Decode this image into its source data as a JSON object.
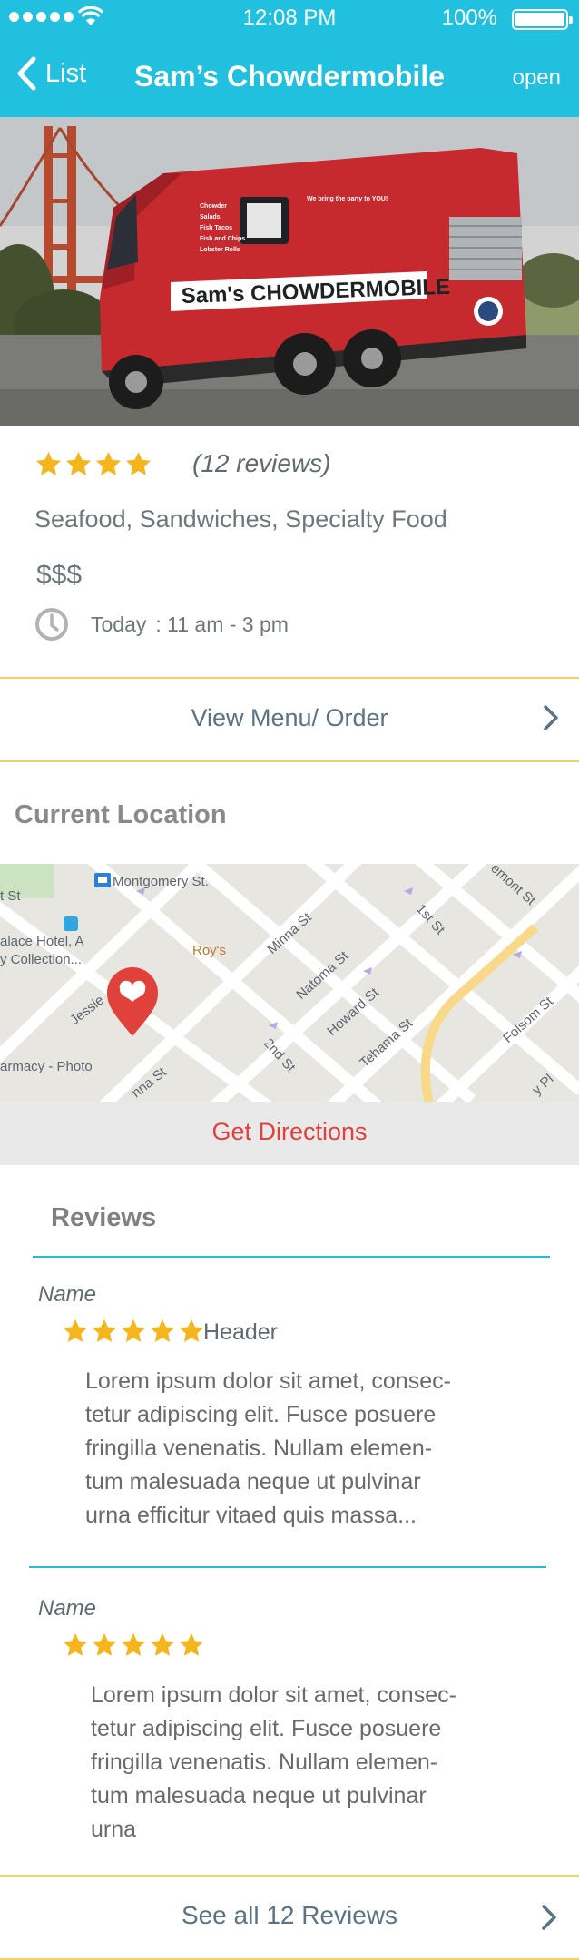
{
  "status_bar": {
    "time": "12:08 PM",
    "battery": "100%",
    "signal_icon": "signal-dots-icon",
    "wifi_icon": "wifi-icon",
    "battery_icon": "battery-icon"
  },
  "nav": {
    "back_label": "List",
    "title": "Sam’s Chowdermobile",
    "status": "open"
  },
  "hero": {
    "brand_text": "Sam's CHOWDERMOBILE",
    "menu_lines": [
      "Chowder",
      "Salads",
      "Fish Tacos",
      "Fish and Chips",
      "Lobster Rolls"
    ],
    "slogan": "We bring the party to YOU!"
  },
  "info": {
    "rating": 4,
    "rating_max": 4,
    "reviews_count": "(12 reviews)",
    "categories": "Seafood, Sandwiches, Specialty Food",
    "price": "$$$",
    "hours_day": "Today",
    "hours_time": ": 11 am - 3 pm"
  },
  "menu_link": {
    "label": "View Menu/ Order"
  },
  "location": {
    "section_title": "Current Location",
    "map_labels": {
      "montgomery": "Montgomery St.",
      "palace": "alace Hotel, A",
      "collection": "y Collection...",
      "pharmacy": "armacy - Photo",
      "roys": "Roy's",
      "minna": "Minna St",
      "natoma": "Natoma St",
      "howard": "Howard St",
      "tehama": "Tehama St",
      "first": "1st St",
      "second": "2nd St",
      "folsom": "Folsom St",
      "mont": "emont St",
      "jessie": "Jessie",
      "nna": "nna St",
      "ndst": "t St",
      "pl": "y Pl"
    },
    "directions_label": "Get Directions"
  },
  "reviews": {
    "section_title": "Reviews",
    "items": [
      {
        "name": "Name",
        "stars": 5,
        "header": "Header",
        "body": "Lorem ipsum dolor sit amet, consec-\ntetur adipiscing elit. Fusce posuere\nfringilla venenatis. Nullam elemen-\ntum malesuada neque ut pulvinar\nurna efficitur vitaed quis massa..."
      },
      {
        "name": "Name",
        "stars": 5,
        "header": "",
        "body": "Lorem ipsum dolor sit amet, consec-\ntetur adipiscing elit. Fusce posuere\nfringilla venenatis. Nullam elemen-\ntum malesuada neque ut pulvinar\nurna"
      }
    ],
    "see_all_label": "See all 12 Reviews"
  },
  "colors": {
    "header_bg": "#21c0df",
    "star": "#f5b51c",
    "accent_red": "#e0413b",
    "divider_yellow": "#f2d268",
    "divider_blue": "#2bb6dc"
  }
}
